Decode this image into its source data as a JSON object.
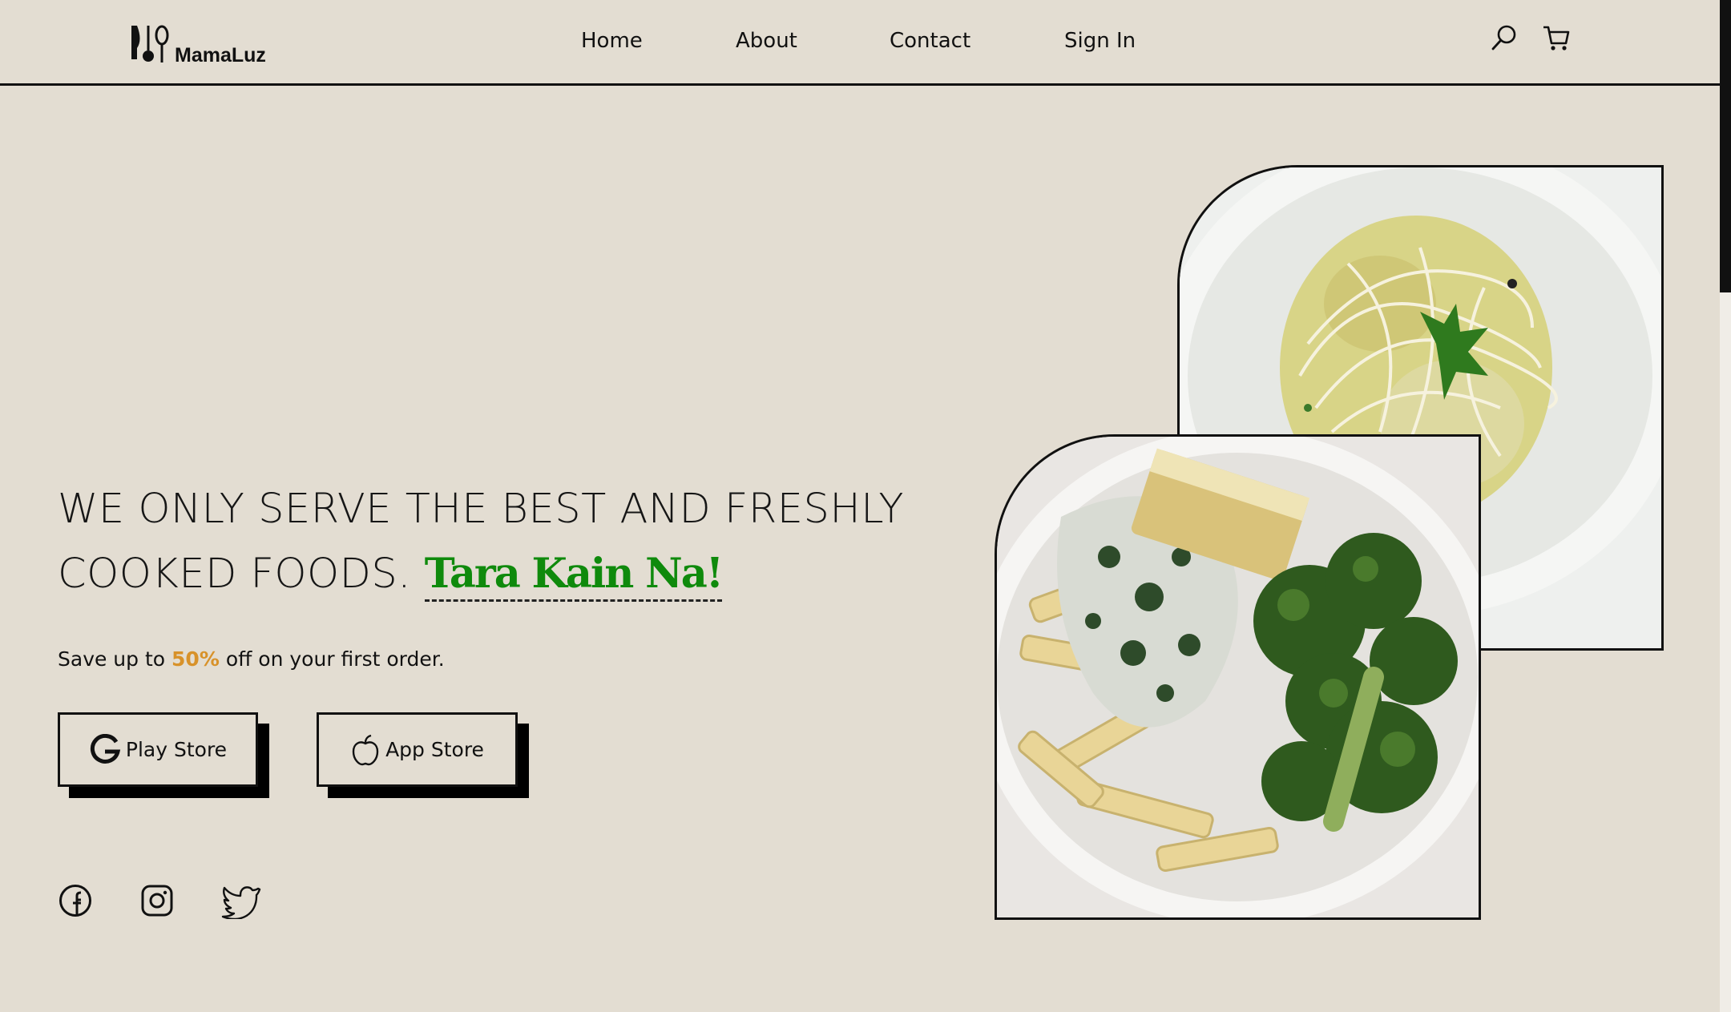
{
  "header": {
    "logo_text": "MamaLuz",
    "nav": [
      {
        "label": "Home"
      },
      {
        "label": "About"
      },
      {
        "label": "Contact"
      },
      {
        "label": "Sign In"
      }
    ],
    "icons": [
      "search-icon",
      "cart-icon"
    ]
  },
  "hero": {
    "headline_text": "We only serve the best and freshly cooked foods.",
    "headline_accent": "Tara Kain Na!",
    "promo_prefix": "Save up to",
    "promo_percent": "50%",
    "promo_suffix": "off on your first order.",
    "buttons": [
      {
        "label": "Play Store",
        "icon": "google-icon"
      },
      {
        "label": "App Store",
        "icon": "apple-icon"
      }
    ],
    "social": [
      "facebook-icon",
      "instagram-icon",
      "twitter-icon"
    ]
  },
  "images": [
    "pasta-with-cheese-photo",
    "penne-with-broccoli-photo"
  ],
  "colors": {
    "background": "#e3ddd2",
    "accent_green": "#0f8a0c",
    "accent_orange": "#d8922a",
    "ink": "#111111"
  }
}
